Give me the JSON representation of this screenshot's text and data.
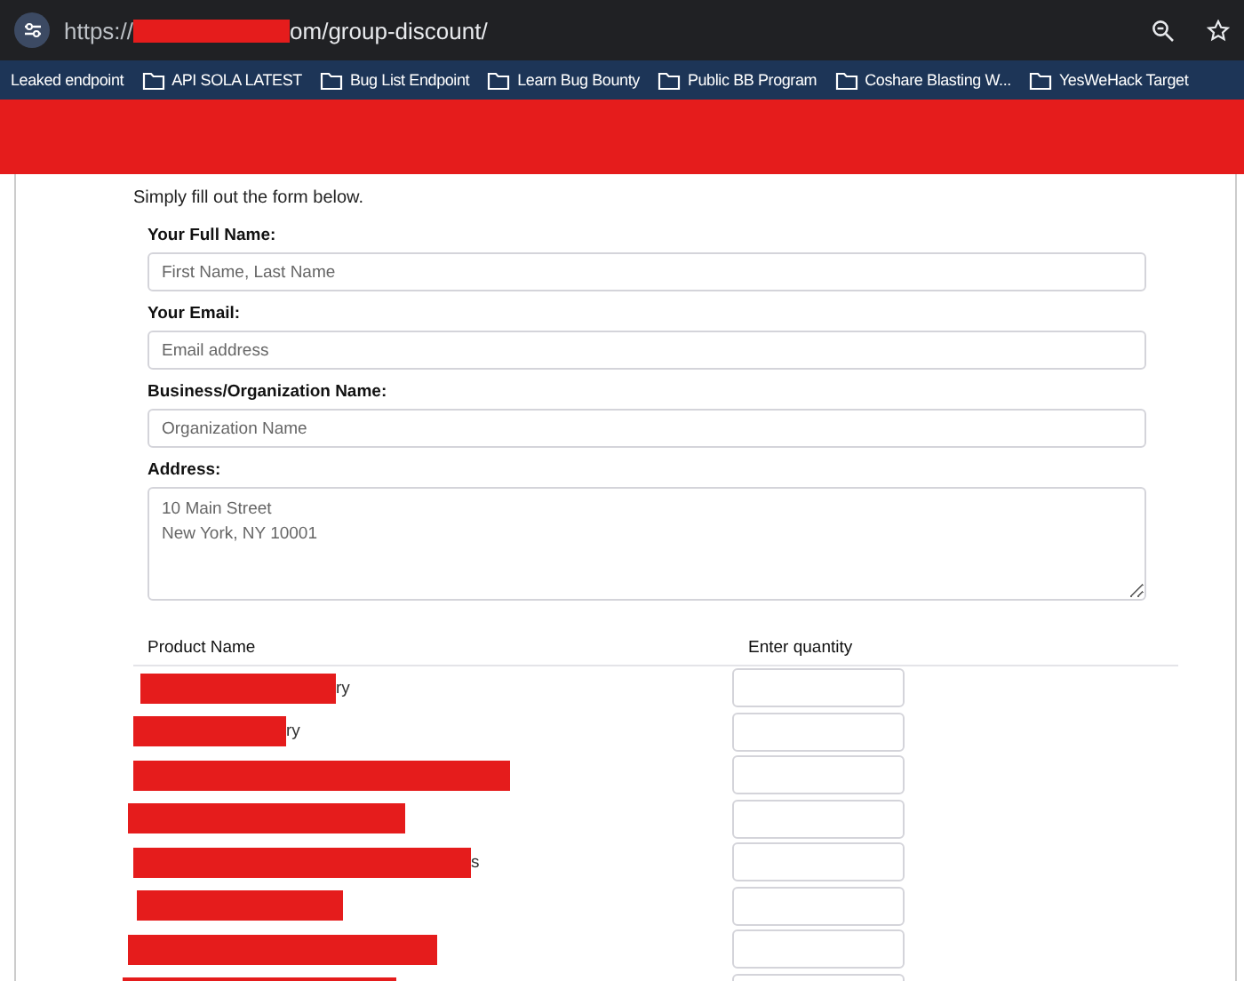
{
  "address_bar": {
    "url_prefix": "https://",
    "url_suffix": "om/group-discount/"
  },
  "bookmarks": [
    {
      "label": "Leaked endpoint",
      "kind": "link"
    },
    {
      "label": "API SOLA LATEST",
      "kind": "folder"
    },
    {
      "label": "Bug List Endpoint",
      "kind": "folder"
    },
    {
      "label": "Learn Bug Bounty",
      "kind": "folder"
    },
    {
      "label": "Public BB Program",
      "kind": "folder"
    },
    {
      "label": "Coshare Blasting W...",
      "kind": "folder"
    },
    {
      "label": "YesWeHack Target",
      "kind": "folder"
    }
  ],
  "intro": "Simply fill out the form below.",
  "form": {
    "fields": [
      {
        "label": "Your Full Name:",
        "placeholder": "First Name, Last Name",
        "kind": "input"
      },
      {
        "label": "Your Email:",
        "placeholder": "Email address",
        "kind": "input"
      },
      {
        "label": "Business/Organization Name:",
        "placeholder": "Organization Name",
        "kind": "input"
      },
      {
        "label": "Address:",
        "placeholder": "10 Main Street\nNew York, NY 10001",
        "kind": "textarea"
      }
    ]
  },
  "table": {
    "columns": [
      "Product Name",
      "Enter quantity"
    ],
    "rows": [
      {
        "product_name": "ry"
      },
      {
        "product_name": "ry"
      },
      {
        "product_name": ""
      },
      {
        "product_name": ""
      },
      {
        "product_name": "s"
      },
      {
        "product_name": ""
      },
      {
        "product_name": ""
      },
      {
        "product_name": ""
      }
    ]
  }
}
